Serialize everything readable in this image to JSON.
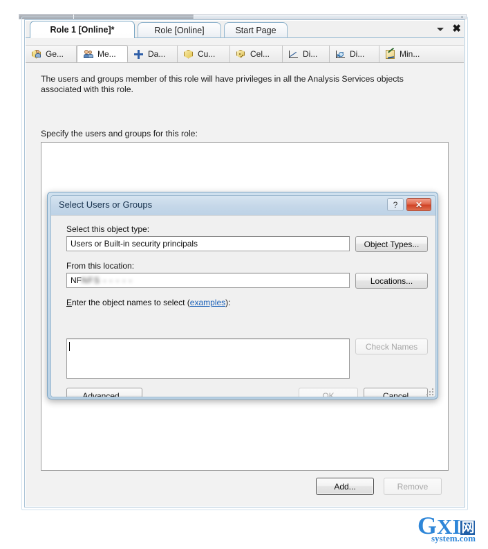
{
  "window": {
    "document_tabs": [
      {
        "label": "Role 1 [Online]*",
        "active": true
      },
      {
        "label": "Role [Online]",
        "active": false
      },
      {
        "label": "Start Page",
        "active": false
      }
    ],
    "tab_dropdown_icon": "chevron-down-icon",
    "tab_close_icon": "close-icon"
  },
  "property_tabs": [
    {
      "label": "Ge...",
      "icon": "general-icon",
      "active": false
    },
    {
      "label": "Me...",
      "icon": "membership-icon",
      "active": true
    },
    {
      "label": "Da...",
      "icon": "data-sources-icon",
      "active": false
    },
    {
      "label": "Cu...",
      "icon": "cubes-icon",
      "active": false
    },
    {
      "label": "Cel...",
      "icon": "cell-data-icon",
      "active": false
    },
    {
      "label": "Di...",
      "icon": "dimensions-icon",
      "active": false
    },
    {
      "label": "Di...",
      "icon": "dimension-data-icon",
      "active": false
    },
    {
      "label": "Min...",
      "icon": "mining-structures-icon",
      "active": false
    }
  ],
  "main": {
    "description": "The users and groups member of this role will have privileges in all the Analysis Services objects associated with this role.",
    "specify_label": "Specify the users and groups for this role:",
    "members_list_items": [],
    "add_button": "Add...",
    "remove_button": "Remove"
  },
  "dialog": {
    "title": "Select Users or Groups",
    "help_button": "?",
    "close_button": "✕",
    "object_type": {
      "label": "Select this object type:",
      "value": "Users or Built-in security principals",
      "button": "Object Types..."
    },
    "location": {
      "label": "From this location:",
      "value": "NFS",
      "value_redacted": "NFS  - - - - -",
      "button": "Locations..."
    },
    "object_names": {
      "label_prefix": "Enter the object names to select (",
      "label_link": "examples",
      "label_suffix": "):",
      "value": "",
      "button": "Check Names"
    },
    "advanced_button": "Advanced...",
    "ok_button": "OK",
    "cancel_button": "Cancel"
  },
  "watermark": {
    "letter_g": "G",
    "letters_xi": "XI",
    "cn_char": "网",
    "sub": "system.com"
  },
  "colors": {
    "accent": "#2e86d8",
    "dialog_frame": "#7fa6c4",
    "close_red": "#cf4226",
    "link": "#1960b8"
  }
}
